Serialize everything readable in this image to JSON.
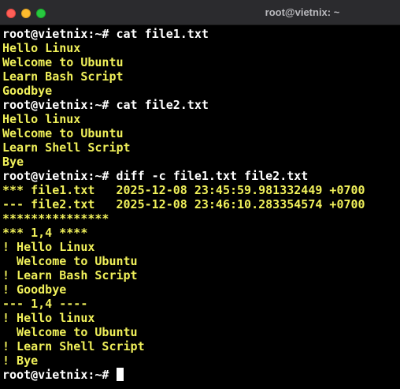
{
  "window": {
    "title": "root@vietnix: ~",
    "controls": {
      "close": "close",
      "minimize": "minimize",
      "maximize": "maximize"
    }
  },
  "colors": {
    "background": "#000000",
    "prompt": "#ffffff",
    "output": "#f0f05a",
    "titlebar": "#2b2b2e"
  },
  "terminal": {
    "lines": [
      {
        "kind": "prompt",
        "text": "root@vietnix:~# cat file1.txt"
      },
      {
        "kind": "output",
        "text": "Hello Linux"
      },
      {
        "kind": "output",
        "text": "Welcome to Ubuntu"
      },
      {
        "kind": "output",
        "text": "Learn Bash Script"
      },
      {
        "kind": "output",
        "text": "Goodbye"
      },
      {
        "kind": "prompt",
        "text": "root@vietnix:~# cat file2.txt"
      },
      {
        "kind": "output",
        "text": "Hello linux"
      },
      {
        "kind": "output",
        "text": "Welcome to Ubuntu"
      },
      {
        "kind": "output",
        "text": "Learn Shell Script"
      },
      {
        "kind": "output",
        "text": "Bye"
      },
      {
        "kind": "prompt",
        "text": "root@vietnix:~# diff -c file1.txt file2.txt"
      },
      {
        "kind": "output",
        "text": "*** file1.txt   2025-12-08 23:45:59.981332449 +0700"
      },
      {
        "kind": "output",
        "text": "--- file2.txt   2025-12-08 23:46:10.283354574 +0700"
      },
      {
        "kind": "output",
        "text": "***************"
      },
      {
        "kind": "output",
        "text": "*** 1,4 ****"
      },
      {
        "kind": "output",
        "text": "! Hello Linux"
      },
      {
        "kind": "output",
        "text": "  Welcome to Ubuntu"
      },
      {
        "kind": "output",
        "text": "! Learn Bash Script"
      },
      {
        "kind": "output",
        "text": "! Goodbye"
      },
      {
        "kind": "output",
        "text": "--- 1,4 ----"
      },
      {
        "kind": "output",
        "text": "! Hello linux"
      },
      {
        "kind": "output",
        "text": "  Welcome to Ubuntu"
      },
      {
        "kind": "output",
        "text": "! Learn Shell Script"
      },
      {
        "kind": "output",
        "text": "! Bye"
      }
    ],
    "current_prompt": "root@vietnix:~# "
  }
}
